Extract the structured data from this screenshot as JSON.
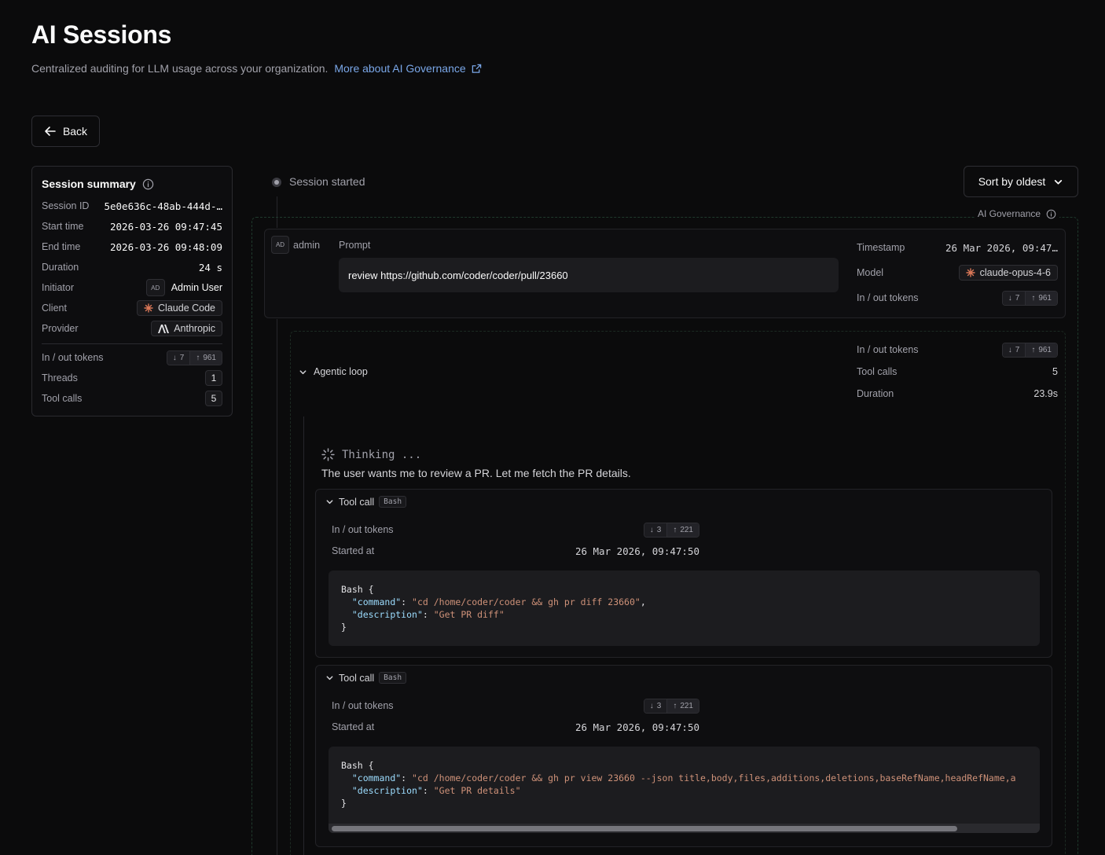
{
  "header": {
    "title": "AI Sessions",
    "subtitle": "Centralized auditing for LLM usage across your organization.",
    "link_label": "More about AI Governance"
  },
  "back_label": "Back",
  "summary": {
    "title": "Session summary",
    "rows": [
      {
        "label": "Session ID",
        "value": "5e0e636c-48ab-444d-…"
      },
      {
        "label": "Start time",
        "value": "2026-03-26 09:47:45"
      },
      {
        "label": "End time",
        "value": "2026-03-26 09:48:09"
      },
      {
        "label": "Duration",
        "value": "24 s"
      }
    ],
    "initiator": {
      "label": "Initiator",
      "avatar": "AD",
      "value": "Admin User"
    },
    "client": {
      "label": "Client",
      "value": "Claude Code",
      "icon": "claude-icon"
    },
    "provider": {
      "label": "Provider",
      "value": "Anthropic",
      "icon": "anthropic-icon"
    },
    "tokens": {
      "label": "In / out tokens",
      "in": "7",
      "out": "961"
    },
    "threads": {
      "label": "Threads",
      "value": "1"
    },
    "tool_calls": {
      "label": "Tool calls",
      "value": "5"
    }
  },
  "timeline": {
    "session_started": "Session started",
    "sort_label": "Sort by oldest",
    "governance_label": "AI Governance"
  },
  "prompt": {
    "avatar": "AD",
    "user": "admin",
    "label": "Prompt",
    "text": "review https://github.com/coder/coder/pull/23660",
    "meta": {
      "timestamp_label": "Timestamp",
      "timestamp": "26 Mar 2026, 09:47…",
      "model_label": "Model",
      "model": "claude-opus-4-6",
      "tokens_label": "In / out tokens",
      "tokens_in": "7",
      "tokens_out": "961"
    }
  },
  "agentic_loop": {
    "title": "Agentic loop",
    "tokens_label": "In / out tokens",
    "tokens_in": "7",
    "tokens_out": "961",
    "tool_calls_label": "Tool calls",
    "tool_calls": "5",
    "duration_label": "Duration",
    "duration": "23.9s",
    "thinking_label": "Thinking ...",
    "thinking_text": "The user wants me to review a PR. Let me fetch the PR details."
  },
  "tool_calls": [
    {
      "title": "Tool call",
      "tag": "Bash",
      "tokens_label": "In / out tokens",
      "tokens_in": "3",
      "tokens_out": "221",
      "started_label": "Started at",
      "started": "26 Mar 2026, 09:47:50",
      "code_head": "Bash {",
      "command_key": "\"command\"",
      "command_val": "\"cd /home/coder/coder && gh pr diff 23660\"",
      "description_key": "\"description\"",
      "description_val": "\"Get PR diff\"",
      "code_tail": "}"
    },
    {
      "title": "Tool call",
      "tag": "Bash",
      "tokens_label": "In / out tokens",
      "tokens_in": "3",
      "tokens_out": "221",
      "started_label": "Started at",
      "started": "26 Mar 2026, 09:47:50",
      "code_head": "Bash {",
      "command_key": "\"command\"",
      "command_val": "\"cd /home/coder/coder && gh pr view 23660 --json title,body,files,additions,deletions,baseRefName,headRefName,a",
      "description_key": "\"description\"",
      "description_val": "\"Get PR details\"",
      "code_tail": "}"
    }
  ],
  "colors": {
    "background": "#0b0b0c",
    "link": "#7aa7e8",
    "json_key": "#9cdcfe",
    "json_string": "#ce9178",
    "governance_border": "#1f3a2c"
  }
}
